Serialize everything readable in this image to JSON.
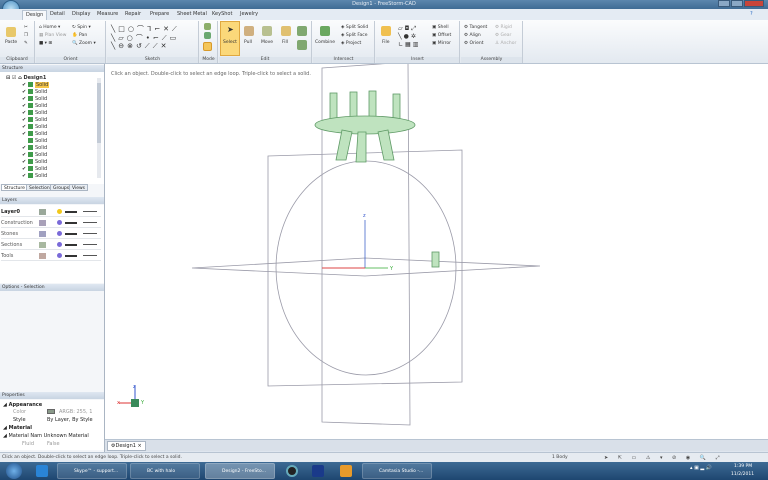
{
  "window": {
    "title": "Design1 - FreeStorm-CAD"
  },
  "ribbon_tabs": [
    "Design",
    "Detail",
    "Display",
    "Measure",
    "Repair",
    "Prepare",
    "Sheet Metal",
    "KeyShot",
    "Jewelry"
  ],
  "groups": {
    "clipboard": {
      "label": "Clipboard",
      "paste": "Paste"
    },
    "orient": {
      "label": "Orient",
      "home": "Home",
      "plan_view": "Plan View",
      "zoom": "Zoom",
      "spin": "Spin",
      "pan": "Pan"
    },
    "sketch": {
      "label": "Sketch"
    },
    "mode": {
      "label": "Mode"
    },
    "edit": {
      "label": "Edit",
      "select": "Select",
      "pull": "Pull",
      "move": "Move",
      "fill": "Fill"
    },
    "intersect": {
      "label": "Intersect",
      "combine": "Combine",
      "split_solid": "Split Solid",
      "split_face": "Split Face",
      "project": "Project"
    },
    "insert": {
      "label": "Insert",
      "file": "File",
      "shell": "Shell",
      "offset": "Offset",
      "mirror": "Mirror"
    },
    "assembly": {
      "label": "Assembly",
      "tangent": "Tangent",
      "align": "Align",
      "orient": "Orient",
      "rigid": "Rigid",
      "gear": "Gear",
      "anchor": "Anchor"
    }
  },
  "structure": {
    "title": "Structure",
    "root": "Design1",
    "items": [
      {
        "label": "Solid",
        "checked": true,
        "selected": true
      },
      {
        "label": "Solid",
        "checked": true
      },
      {
        "label": "Solid",
        "checked": true
      },
      {
        "label": "Solid",
        "checked": true
      },
      {
        "label": "Solid",
        "checked": true
      },
      {
        "label": "Solid",
        "checked": true
      },
      {
        "label": "Solid",
        "checked": true
      },
      {
        "label": "Solid",
        "checked": true
      },
      {
        "label": "Solid",
        "checked": false
      },
      {
        "label": "Solid",
        "checked": true
      },
      {
        "label": "Solid",
        "checked": true
      },
      {
        "label": "Solid",
        "checked": true
      },
      {
        "label": "Solid",
        "checked": true
      },
      {
        "label": "Solid",
        "checked": true
      }
    ],
    "tabs": [
      "Structure",
      "Selection",
      "Groups",
      "Views"
    ]
  },
  "layers": {
    "title": "Layers",
    "items": [
      {
        "name": "Layer0",
        "color": "#9aa89a",
        "bulb": "#f2c81a"
      },
      {
        "name": "Construction",
        "color": "#a8a0b8",
        "bulb": "#7a6ad8"
      },
      {
        "name": "Stones",
        "color": "#a0a0c0",
        "bulb": "#7a6ad8"
      },
      {
        "name": "Sections",
        "color": "#a8b8a0",
        "bulb": "#7a6ad8"
      },
      {
        "name": "Tools",
        "color": "#c0a8a0",
        "bulb": "#7a6ad8"
      }
    ]
  },
  "options": {
    "title": "Options - Selection"
  },
  "properties": {
    "title": "Properties",
    "appearance": "Appearance",
    "color_label": "Color",
    "color_value": "ARGB: 255, 1",
    "style_label": "Style",
    "style_value": "By Layer, By Style",
    "material": "Material",
    "material_name_label": "Material Nam",
    "material_name_value": "Unknown Material",
    "fluid_label": "Fluid",
    "fluid_value": "False"
  },
  "viewport": {
    "hint": "Click an object. Double-click to select an edge loop. Triple-click to select a solid.",
    "axis_x": "x",
    "axis_y": "Y",
    "axis_z": "z"
  },
  "doc_tab": "Design1",
  "status": {
    "text": "Click an object. Double-click to select an edge loop. Triple-click to select a solid.",
    "count": "1 Body"
  },
  "taskbar": {
    "items": [
      "Skype™ - support...",
      "BC with halo",
      "Design2 - FreeSto...",
      "Camtasia Studio -..."
    ],
    "time": "1:39 PM",
    "date": "11/2/2011"
  }
}
